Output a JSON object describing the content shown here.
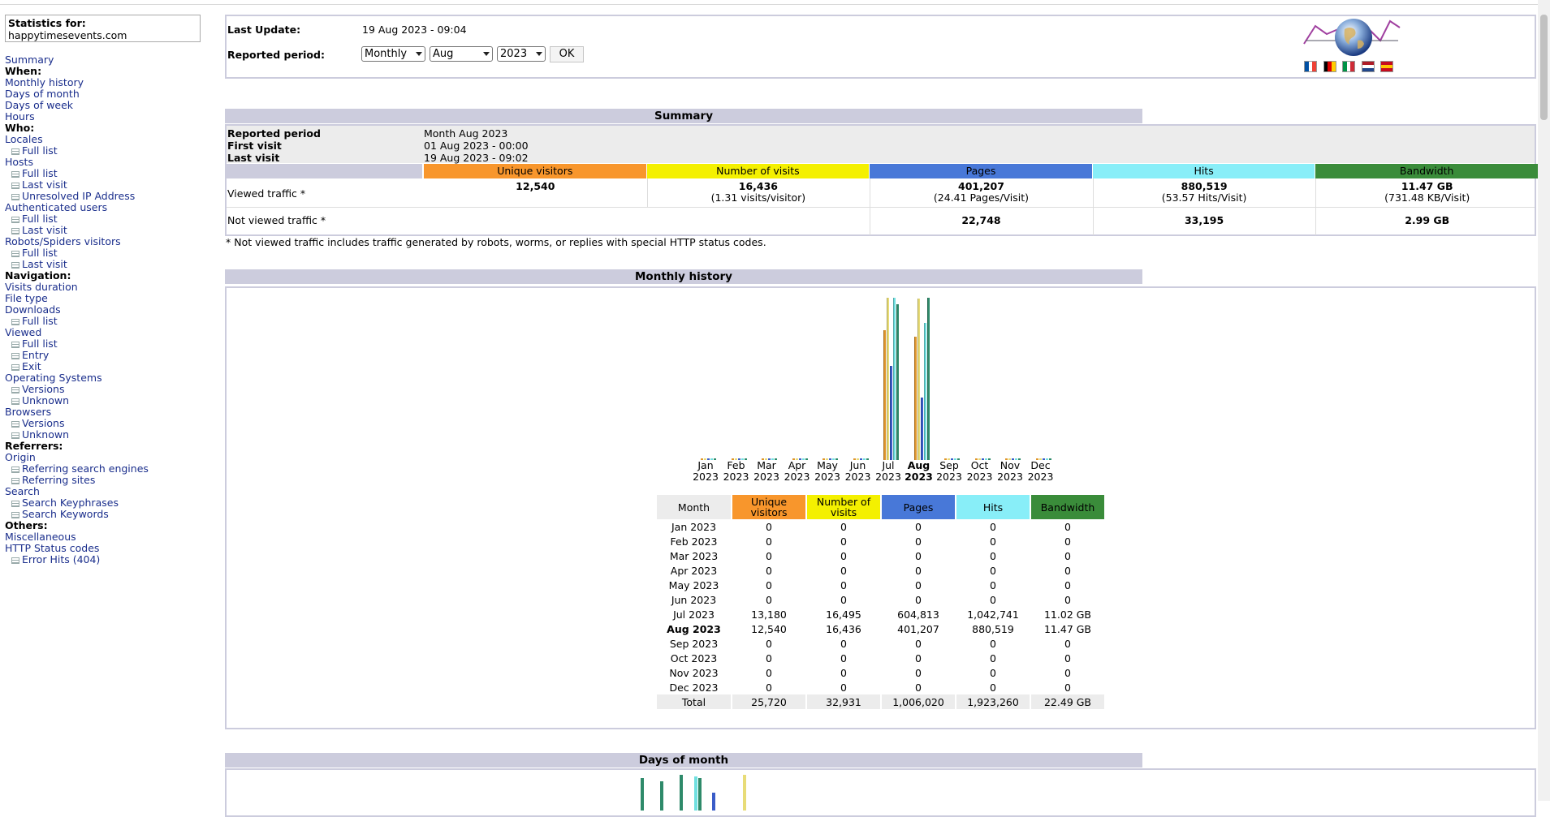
{
  "stats_for": {
    "label": "Statistics for:",
    "domain": "happytimesevents.com"
  },
  "menu": [
    {
      "t": "link",
      "label": "Summary"
    },
    {
      "t": "hdr",
      "label": "When:"
    },
    {
      "t": "link",
      "label": "Monthly history"
    },
    {
      "t": "link",
      "label": "Days of month"
    },
    {
      "t": "link",
      "label": "Days of week"
    },
    {
      "t": "link",
      "label": "Hours"
    },
    {
      "t": "hdr",
      "label": "Who:"
    },
    {
      "t": "link",
      "label": "Locales"
    },
    {
      "t": "sub",
      "label": "Full list"
    },
    {
      "t": "link",
      "label": "Hosts"
    },
    {
      "t": "sub",
      "label": "Full list"
    },
    {
      "t": "sub",
      "label": "Last visit"
    },
    {
      "t": "sub",
      "label": "Unresolved IP Address"
    },
    {
      "t": "link",
      "label": "Authenticated users"
    },
    {
      "t": "sub",
      "label": "Full list"
    },
    {
      "t": "sub",
      "label": "Last visit"
    },
    {
      "t": "link",
      "label": "Robots/Spiders visitors"
    },
    {
      "t": "sub",
      "label": "Full list"
    },
    {
      "t": "sub",
      "label": "Last visit"
    },
    {
      "t": "hdr",
      "label": "Navigation:"
    },
    {
      "t": "link",
      "label": "Visits duration"
    },
    {
      "t": "link",
      "label": "File type"
    },
    {
      "t": "link",
      "label": "Downloads"
    },
    {
      "t": "sub",
      "label": "Full list"
    },
    {
      "t": "link",
      "label": "Viewed"
    },
    {
      "t": "sub",
      "label": "Full list"
    },
    {
      "t": "sub",
      "label": "Entry"
    },
    {
      "t": "sub",
      "label": "Exit"
    },
    {
      "t": "link",
      "label": "Operating Systems"
    },
    {
      "t": "sub",
      "label": "Versions"
    },
    {
      "t": "sub",
      "label": "Unknown"
    },
    {
      "t": "link",
      "label": "Browsers"
    },
    {
      "t": "sub",
      "label": "Versions"
    },
    {
      "t": "sub",
      "label": "Unknown"
    },
    {
      "t": "hdr",
      "label": "Referrers:"
    },
    {
      "t": "link",
      "label": "Origin"
    },
    {
      "t": "sub",
      "label": "Referring search engines"
    },
    {
      "t": "sub",
      "label": "Referring sites"
    },
    {
      "t": "link",
      "label": "Search"
    },
    {
      "t": "sub",
      "label": "Search Keyphrases"
    },
    {
      "t": "sub",
      "label": "Search Keywords"
    },
    {
      "t": "hdr",
      "label": "Others:"
    },
    {
      "t": "link",
      "label": "Miscellaneous"
    },
    {
      "t": "link",
      "label": "HTTP Status codes"
    },
    {
      "t": "sub",
      "label": "Error Hits (404)"
    }
  ],
  "topinfo": {
    "last_update_label": "Last Update:",
    "last_update_value": "19 Aug 2023 - 09:04",
    "period_label": "Reported period:",
    "period_type": "Monthly",
    "month": "Aug",
    "year": "2023",
    "ok_label": "OK",
    "flag_colors": [
      [
        "#0050a4",
        "#ffffff",
        "#ef4135"
      ],
      [
        "#000000",
        "#dd0000",
        "#ffce00"
      ],
      [
        "#009246",
        "#ffffff",
        "#ce2b37"
      ],
      [
        "#ae1c28",
        "#ffffff",
        "#21468b"
      ],
      [
        "#c60b1e",
        "#ffc400",
        "#c60b1e"
      ]
    ]
  },
  "summary": {
    "title": "Summary",
    "reported_period_label": "Reported period",
    "reported_period_value": "Month Aug 2023",
    "first_visit_label": "First visit",
    "first_visit_value": "01 Aug 2023 - 00:00",
    "last_visit_label": "Last visit",
    "last_visit_value": "19 Aug 2023 - 09:02",
    "columns": [
      "Unique visitors",
      "Number of visits",
      "Pages",
      "Hits",
      "Bandwidth"
    ],
    "column_colors": [
      "#f8962c",
      "#f4f000",
      "#4878d8",
      "#88eef8",
      "#3a8c3a"
    ],
    "viewed_label": "Viewed traffic *",
    "viewed": [
      {
        "v": "12,540",
        "s": ""
      },
      {
        "v": "16,436",
        "s": "(1.31 visits/visitor)"
      },
      {
        "v": "401,207",
        "s": "(24.41 Pages/Visit)"
      },
      {
        "v": "880,519",
        "s": "(53.57 Hits/Visit)"
      },
      {
        "v": "11.47 GB",
        "s": "(731.48 KB/Visit)"
      }
    ],
    "not_viewed_label": "Not viewed traffic *",
    "not_viewed": [
      "22,748",
      "33,195",
      "2.99 GB"
    ],
    "footnote": "* Not viewed traffic includes traffic generated by robots, worms, or replies with special HTTP status codes."
  },
  "monthly": {
    "title": "Monthly history",
    "headers": [
      "Month",
      "Unique visitors",
      "Number of visits",
      "Pages",
      "Hits",
      "Bandwidth"
    ],
    "rows": [
      [
        "Jan 2023",
        "0",
        "0",
        "0",
        "0",
        "0"
      ],
      [
        "Feb 2023",
        "0",
        "0",
        "0",
        "0",
        "0"
      ],
      [
        "Mar 2023",
        "0",
        "0",
        "0",
        "0",
        "0"
      ],
      [
        "Apr 2023",
        "0",
        "0",
        "0",
        "0",
        "0"
      ],
      [
        "May 2023",
        "0",
        "0",
        "0",
        "0",
        "0"
      ],
      [
        "Jun 2023",
        "0",
        "0",
        "0",
        "0",
        "0"
      ],
      [
        "Jul 2023",
        "13,180",
        "16,495",
        "604,813",
        "1,042,741",
        "11.02 GB"
      ],
      [
        "Aug 2023",
        "12,540",
        "16,436",
        "401,207",
        "880,519",
        "11.47 GB"
      ],
      [
        "Sep 2023",
        "0",
        "0",
        "0",
        "0",
        "0"
      ],
      [
        "Oct 2023",
        "0",
        "0",
        "0",
        "0",
        "0"
      ],
      [
        "Nov 2023",
        "0",
        "0",
        "0",
        "0",
        "0"
      ],
      [
        "Dec 2023",
        "0",
        "0",
        "0",
        "0",
        "0"
      ]
    ],
    "total": [
      "Total",
      "25,720",
      "32,931",
      "1,006,020",
      "1,923,260",
      "22.49 GB"
    ],
    "current_row": 7
  },
  "chart_data": {
    "type": "bar",
    "categories": [
      "Jan 2023",
      "Feb 2023",
      "Mar 2023",
      "Apr 2023",
      "May 2023",
      "Jun 2023",
      "Jul 2023",
      "Aug 2023",
      "Sep 2023",
      "Oct 2023",
      "Nov 2023",
      "Dec 2023"
    ],
    "tick_month": [
      "Jan",
      "Feb",
      "Mar",
      "Apr",
      "May",
      "Jun",
      "Jul",
      "Aug",
      "Sep",
      "Oct",
      "Nov",
      "Dec"
    ],
    "tick_year": [
      "2023",
      "2023",
      "2023",
      "2023",
      "2023",
      "2023",
      "2023",
      "2023",
      "2023",
      "2023",
      "2023",
      "2023"
    ],
    "bold_category": 7,
    "series": [
      {
        "name": "Unique visitors",
        "color": "#e0962c",
        "values": [
          0,
          0,
          0,
          0,
          0,
          0,
          13180,
          12540,
          0,
          0,
          0,
          0
        ]
      },
      {
        "name": "Number of visits",
        "color": "#e8dc78",
        "values": [
          0,
          0,
          0,
          0,
          0,
          0,
          16495,
          16436,
          0,
          0,
          0,
          0
        ]
      },
      {
        "name": "Pages",
        "color": "#3a5cc8",
        "values": [
          0,
          0,
          0,
          0,
          0,
          0,
          604813,
          401207,
          0,
          0,
          0,
          0
        ]
      },
      {
        "name": "Hits",
        "color": "#70e0e0",
        "values": [
          0,
          0,
          0,
          0,
          0,
          0,
          1042741,
          880519,
          0,
          0,
          0,
          0
        ]
      },
      {
        "name": "Bandwidth",
        "color": "#2e8a6a",
        "values": [
          0,
          0,
          0,
          0,
          0,
          0,
          11.02,
          11.47,
          0,
          0,
          0,
          0
        ]
      }
    ],
    "scale_groups": [
      [
        0,
        1
      ],
      [
        2,
        3
      ],
      [
        4
      ]
    ]
  },
  "days": {
    "title": "Days of month"
  }
}
